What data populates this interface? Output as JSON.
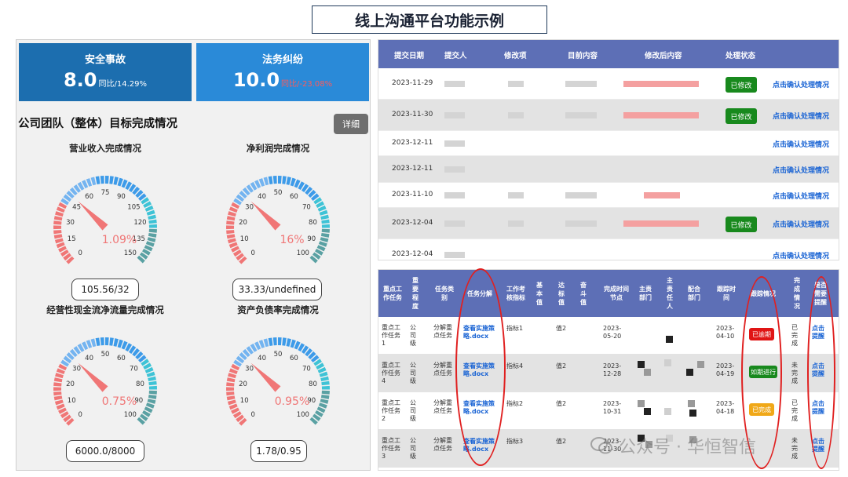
{
  "banner": "线上沟通平台功能示例",
  "kpis": [
    {
      "label": "安全事故",
      "value": "8.0",
      "sub": "同比/14.29%"
    },
    {
      "label": "法务纠纷",
      "value": "10.0",
      "sub": "同比/-23.08%"
    }
  ],
  "section_title": "公司团队（整体）目标完成情况",
  "detail_button": "详细",
  "gauges": [
    {
      "title": "营业收入完成情况",
      "max": 150,
      "ticks": [
        "0",
        "15",
        "30",
        "45",
        "60",
        "75",
        "90",
        "105",
        "120",
        "135",
        "150"
      ],
      "value": 1.09,
      "percent_text": "1.09%",
      "box": "105.56/32"
    },
    {
      "title": "净利润完成情况",
      "max": 100,
      "ticks": [
        "0",
        "10",
        "20",
        "30",
        "40",
        "50",
        "60",
        "70",
        "80",
        "90",
        "100"
      ],
      "value": 16,
      "percent_text": "16%",
      "box": "33.33/undefined"
    },
    {
      "title": "经营性现金流净流量完成情况",
      "max": 100,
      "ticks": [
        "0",
        "10",
        "20",
        "30",
        "40",
        "50",
        "60",
        "70",
        "80",
        "90",
        "100"
      ],
      "value": 0.75,
      "percent_text": "0.75%",
      "box": "6000.0/8000"
    },
    {
      "title": "资产负债率完成情况",
      "max": 100,
      "ticks": [
        "0",
        "10",
        "20",
        "30",
        "40",
        "50",
        "60",
        "70",
        "80",
        "90",
        "100"
      ],
      "value": 0.95,
      "percent_text": "0.95%",
      "box": "1.78/0.95"
    }
  ],
  "colors": {
    "gauge_red": "#f07676",
    "gauge_blue": "#3d9be9",
    "gauge_teal": "#5aa1a3",
    "needle": "#f07676"
  },
  "top_table": {
    "columns": [
      "提交日期",
      "提交人",
      "修改项",
      "目前内容",
      "修改后内容",
      "处理状态"
    ],
    "rows": [
      {
        "date": "2023-11-29",
        "badge": "已修改",
        "link": "点击确认处理情况"
      },
      {
        "date": "2023-11-30",
        "badge": "已修改",
        "link": "点击确认处理情况"
      },
      {
        "date": "2023-12-11",
        "badge": "",
        "link": "点击确认处理情况"
      },
      {
        "date": "2023-12-11",
        "badge": "",
        "link": "点击确认处理情况"
      },
      {
        "date": "2023-11-10",
        "badge": "",
        "link": "点击确认处理情况"
      },
      {
        "date": "2023-12-04",
        "badge": "已修改",
        "link": "点击确认处理情况"
      },
      {
        "date": "2023-12-04",
        "badge": "",
        "link": "点击确认处理情况"
      }
    ]
  },
  "bottom_table": {
    "columns": [
      "重点工作任务",
      "重要程度",
      "任务类别",
      "任务分解",
      "工作考核指标",
      "基本值",
      "达标值",
      "奋斗值",
      "完成时间节点",
      "主责部门",
      "主责任人",
      "配合部门",
      "跟踪时间",
      "跟踪情况",
      "完成情况",
      "是否需要提醒"
    ],
    "rows": [
      {
        "task": "重点工作任务1",
        "level": "公司级",
        "category": "分解重点任务",
        "file": "查看实施策略.docx",
        "indicator": "指标1",
        "target": "值2",
        "deadline": "2023-05-20",
        "track_time": "2023-04-10",
        "status": "已逾期",
        "status_color": "#e01515",
        "done": "已完成",
        "remind": "点击提醒"
      },
      {
        "task": "重点工作任务4",
        "level": "公司级",
        "category": "分解重点任务",
        "file": "查看实施策略.docx",
        "indicator": "指标4",
        "target": "值2",
        "deadline": "2023-12-28",
        "track_time": "2023-04-19",
        "status": "如期进行",
        "status_color": "#18891d",
        "done": "未完成",
        "remind": "点击提醒"
      },
      {
        "task": "重点工作任务2",
        "level": "公司级",
        "category": "分解重点任务",
        "file": "查看实施策略.docx",
        "indicator": "指标2",
        "target": "值2",
        "deadline": "2023-10-31",
        "track_time": "2023-04-18",
        "status": "已完成",
        "status_color": "#f0a818",
        "done": "已完成",
        "remind": "点击提醒"
      },
      {
        "task": "重点工作任务3",
        "level": "公司级",
        "category": "分解重点任务",
        "file": "查看实施策略.docx",
        "indicator": "指标3",
        "target": "值2",
        "deadline": "2023-11-30",
        "track_time": "",
        "status": "",
        "status_color": "",
        "done": "未完成",
        "remind": "点击提醒"
      }
    ]
  },
  "watermark": "公众号 · 华恒智信"
}
